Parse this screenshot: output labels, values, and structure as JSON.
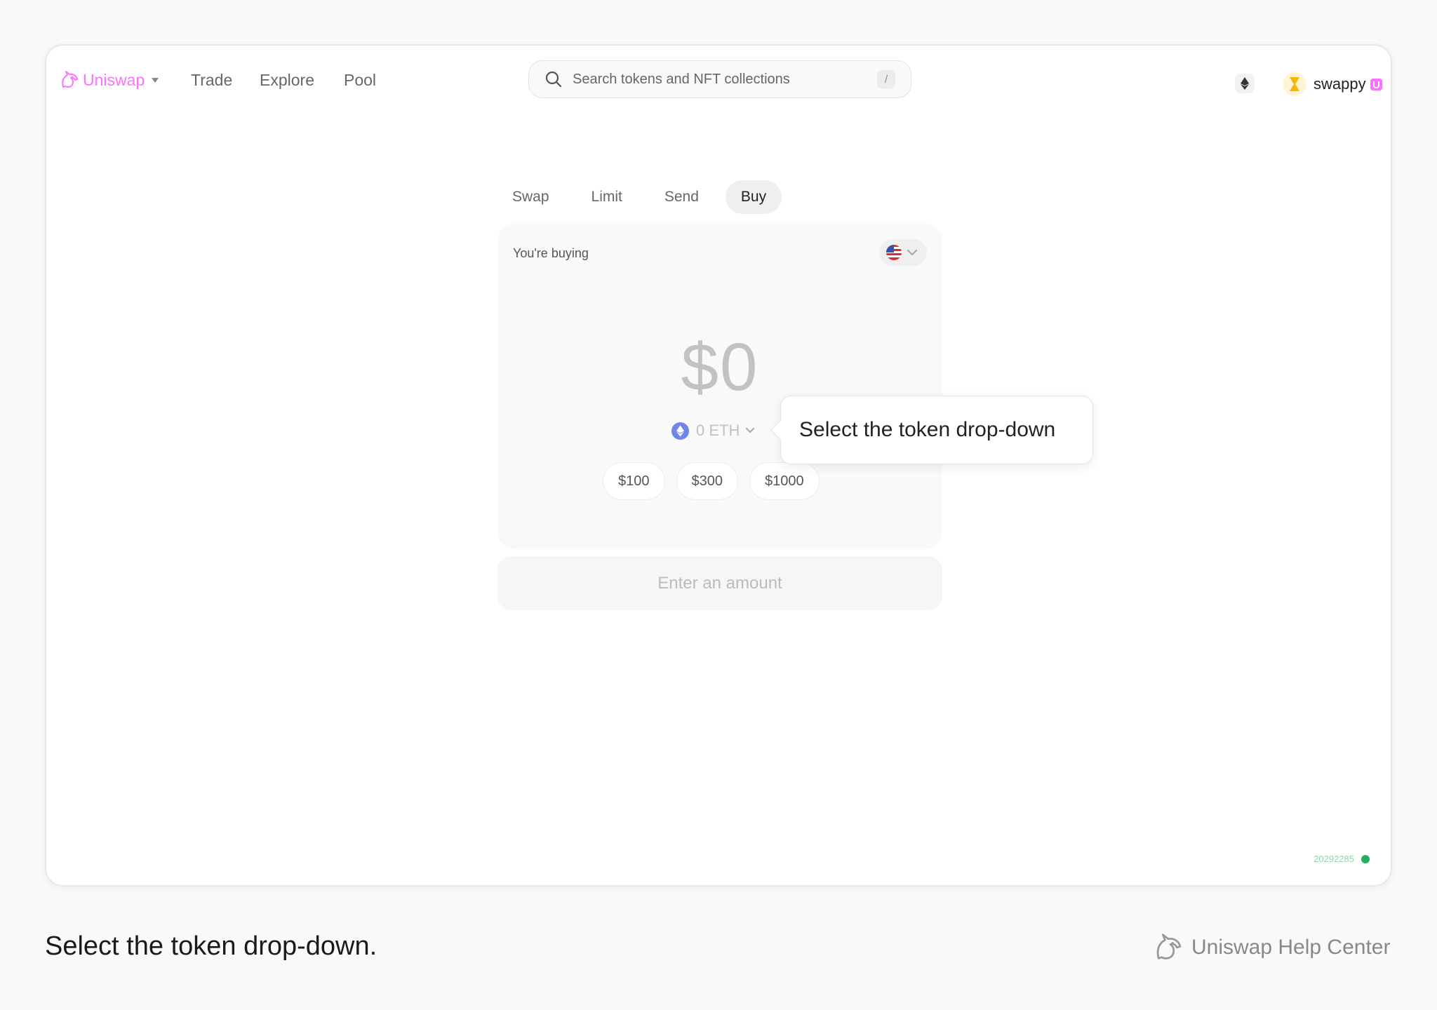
{
  "nav": {
    "brand": "Uniswap",
    "links": [
      "Trade",
      "Explore",
      "Pool"
    ],
    "search_placeholder": "Search tokens and NFT collections",
    "search_shortcut": "/",
    "account_name": "swappy"
  },
  "tabs": [
    {
      "label": "Swap",
      "active": false
    },
    {
      "label": "Limit",
      "active": false
    },
    {
      "label": "Send",
      "active": false
    },
    {
      "label": "Buy",
      "active": true
    }
  ],
  "buy_card": {
    "label": "You're buying",
    "amount": "$0",
    "token_amount": "0 ETH",
    "presets": [
      "$100",
      "$300",
      "$1000"
    ],
    "cta_label": "Enter an amount"
  },
  "tooltip": {
    "text": "Select the token drop-down"
  },
  "version": "20292285",
  "footer": {
    "caption": "Select the token drop-down.",
    "help_center": "Uniswap Help Center"
  },
  "colors": {
    "brand_pink": "#fc72ff",
    "eth_blue": "#6f86e8",
    "status_green": "#27ae60"
  },
  "icons": {
    "brand": "unicorn-icon",
    "search": "search-icon",
    "network": "ethereum-icon",
    "avatar": "hourglass-icon",
    "currency": "us-flag-icon",
    "token": "eth-icon"
  }
}
